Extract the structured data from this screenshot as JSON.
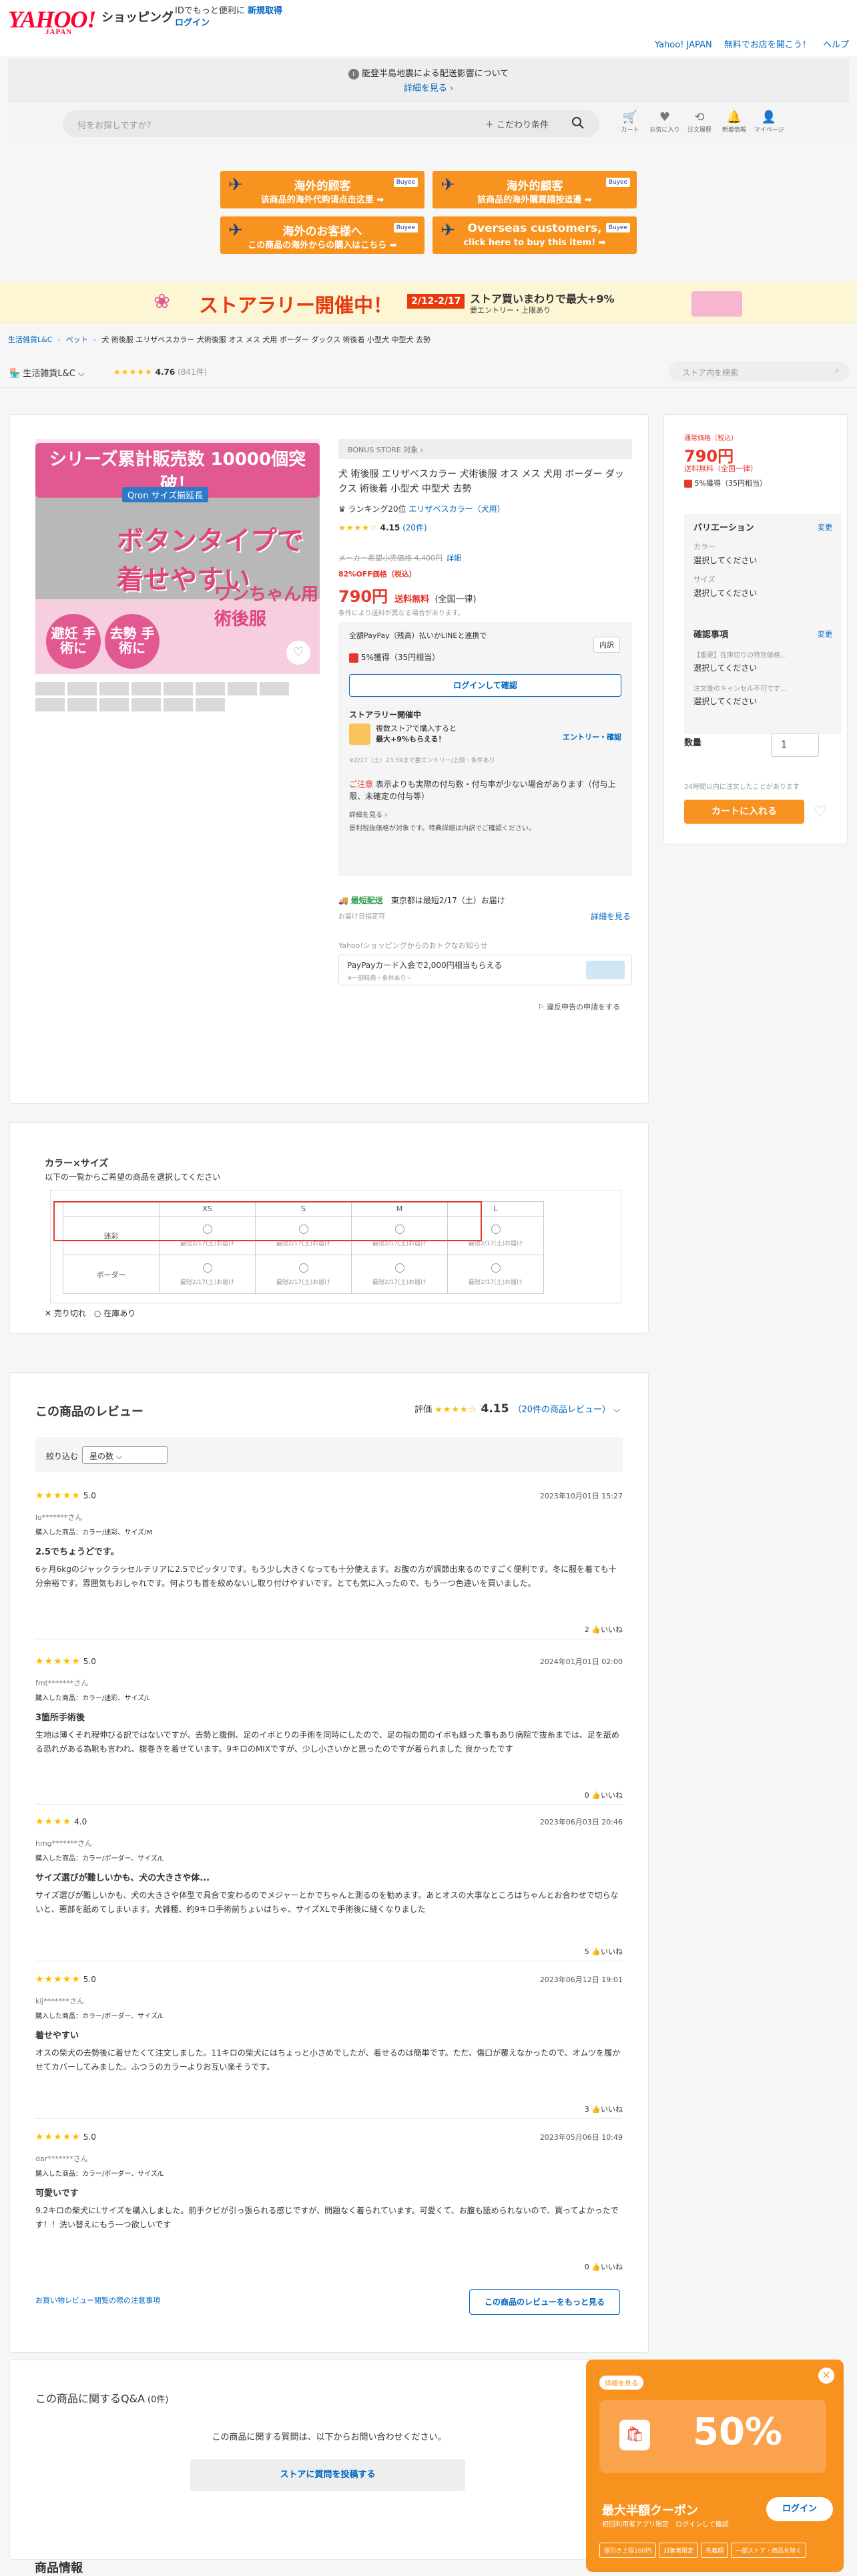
{
  "header": {
    "logo": "YAHOO!",
    "logo_sub": "JAPAN",
    "title": "ショッピング",
    "msg1": "IDでもっと便利に",
    "msg_link": "新規取得",
    "login": "ログイン",
    "right_links": [
      "Yahoo! JAPAN",
      "無料でお店を開こう！",
      "ヘルプ"
    ]
  },
  "notice": {
    "text": "能登半島地震による配送影響について",
    "link": "詳細を見る ›"
  },
  "search": {
    "placeholder": "何をお探しですか？",
    "conditions": "こだわり条件",
    "nav": [
      {
        "icon": "🛒",
        "label": "カート"
      },
      {
        "icon": "♥",
        "label": "お気に入り"
      },
      {
        "icon": "⟲",
        "label": "注文履歴"
      },
      {
        "icon": "🔔",
        "label": "新着情報"
      },
      {
        "icon": "👤",
        "label": "マイページ"
      }
    ]
  },
  "banners": [
    {
      "t1": "海外的顾客",
      "t2": "该商品的海外代购请点击这里 ➡"
    },
    {
      "t1": "海外的顧客",
      "t2": "該商品的海外購買請按這邊 ➡"
    },
    {
      "t1": "海外のお客様へ",
      "t2": "この商品の海外からの購入はこちら ➡"
    },
    {
      "t1": "Overseas customers,",
      "t2": "click here to buy this item! ➡"
    }
  ],
  "buyee": "Buyee",
  "store_rally": {
    "headline": "ストアラリー開催中！",
    "date": "2/12-2/17",
    "sub": "ストア買いまわりで最大+9%",
    "sub2": "要エントリー・上限あり"
  },
  "breadcrumb": [
    "生活雑貨L&C",
    "ペット",
    "犬 術後服 エリザベスカラー 犬術後服 オス メス 犬用 ボーダー ダックス 術後着 小型犬 中型犬 去勢"
  ],
  "store": {
    "name": "生活雑貨L&C",
    "rating": "4.76",
    "count": "(841件)",
    "search_placeholder": "ストア内を検索"
  },
  "product": {
    "image_top": "シリーズ累計販売数 10000個突破！",
    "image_brand": "Qron サイズ揃延長",
    "image_big": "ボタンタイプで着せやすい",
    "image_sub": "ワンちゃん用 術後服",
    "image_c1": "避妊 手術に",
    "image_c2": "去勢 手術に",
    "bonus": "BONUS STORE 対象 ›",
    "title": "犬 術後服 エリザベスカラー 犬術後服 オス メス 犬用 ボーダー ダックス 術後着 小型犬 中型犬 去勢",
    "rank": "ランキング20位",
    "rank_link": "エリザベスカラー（犬用）",
    "rating": "4.15",
    "reviews": "(20件)",
    "old_price": "メーカー希望小売価格 4,400円",
    "old_detail": "詳細",
    "discount": "82%OFF価格（税込）",
    "price": "790円",
    "price_suffix": "送料無料",
    "price_all": "(全国一律)",
    "price_note": "条件により送料が異なる場合があります。",
    "pay_line": "全額PayPay（残高）払いかLINEと連携で",
    "pay_btn": "内訳",
    "pay_pts": "5%獲得（35円相当）",
    "login_btn": "ログインして確認",
    "rally_h": "ストアラリー開催中",
    "rally_t1": "複数ストアで購入すると",
    "rally_t2": "最大+9%もらえる！",
    "rally_entry": "エントリー・確認",
    "rally_note": "※2/17（土）23:59まで要エントリー/上限・条件あり",
    "caution_label": "ご注意",
    "caution": "表示よりも実際の付与数・付与率が少ない場合があります（付与上限、未確定の付与等）",
    "caution_more": "詳細を見る ›",
    "caution_2": "景利税抜価格が対象です。特典詳細は内訳でご確認ください。",
    "ship_label": "最短配送",
    "ship_text": "東京都は最短2/17（土）お届け",
    "ship_note": "お届け日指定可",
    "ship_more": "詳細を見る",
    "yprom": "Yahoo!ショッピングからのおトクなお知らせ",
    "card_t": "PayPayカード入会で2,000円相当もらえる",
    "card_s": "※一部特典・条件あり ›",
    "report": "違反申告の申請をする"
  },
  "side": {
    "label": "通常価格（税込）",
    "price": "790円",
    "free": "送料無料（全国一律）",
    "pts": "5%獲得（35円相当）",
    "var_h": "バリエーション",
    "change": "変更",
    "k1": "カラー",
    "v1": "選択してください",
    "k2": "サイズ",
    "v2": "選択してください",
    "conf_h": "確認事項",
    "ck1": "【重要】在庫切りの特別価格...",
    "cv1": "選択してください",
    "ck2": "注文後のキャンセル不可です...",
    "cv2": "選択してください",
    "qty_label": "数量",
    "qty": "1",
    "note": "24時間以内に注文したことがあります",
    "cart": "カートに入れる"
  },
  "options": {
    "title": "カラー×サイズ",
    "sub": "以下の一覧からご希望の商品を選択してください",
    "cols": [
      "XS",
      "S",
      "M",
      "L"
    ],
    "rows": [
      "迷彩",
      "ボーダー"
    ],
    "cell_note": "最短2/17(土)お届け",
    "legend1": "売り切れ",
    "legend2": "在庫あり"
  },
  "reviews": {
    "title": "この商品のレビュー",
    "score_label": "評価",
    "score": "4.15",
    "score_link": "（20件の商品レビュー）",
    "filter_label": "絞り込む",
    "filter_val": "星の数",
    "items": [
      {
        "stars": "★★★★★",
        "n": "5.0",
        "date": "2023年10月01日 15:27",
        "user": "lo*******さん",
        "bought": "購入した商品：カラー/迷彩、サイズ/M",
        "title": "2.5でちょうどです。",
        "body": "6ヶ月6kgのジャックラッセルテリアに2.5でピッタリです。もう少し大きくなっても十分使えます。お腹の方が調節出来るのですごく便利です。冬に服を着ても十分余裕です。雰囲気もおしゃれです。何よりも首を絞めないし取り付けやすいです。とても気に入ったので、もう一つ色違いを買いました。",
        "likes": "2"
      },
      {
        "stars": "★★★★★",
        "n": "5.0",
        "date": "2024年01月01日 02:00",
        "user": "fmt*******さん",
        "bought": "購入した商品：カラー/迷彩、サイズ/L",
        "title": "3箇所手術後",
        "body": "生地は薄くそれ程伸びる訳ではないですが、去勢と腹側、足のイボとりの手術を同時にしたので、足の指の間のイボも縫った事もあり病院で抜糸までは、足を舐める恐れがある為靴も言われ、腹巻きを着せています。9キロのMIXですが、少し小さいかと思ったのですが着られました 良かったです",
        "likes": "0"
      },
      {
        "stars": "★★★★",
        "n": "4.0",
        "date": "2023年06月03日 20:46",
        "user": "hmg*******さん",
        "bought": "購入した商品：カラー/ボーダー、サイズ/L",
        "title": "サイズ選びが難しいかも、犬の大きさや体...",
        "body": "サイズ選びが難しいかも、犬の大きさや体型で具合で変わるのでメジャーとかでちゃんと測るのを勧めます。あとオスの大事なところはちゃんとお合わせで切らないと、悪部を舐めてしまいます。犬雑種、約9キロ手術前ちょいはちゃ、サイズXLで手術後に縫くなりました",
        "likes": "5"
      },
      {
        "stars": "★★★★★",
        "n": "5.0",
        "date": "2023年06月12日 19:01",
        "user": "kij*******さん",
        "bought": "購入した商品：カラー/ボーダー、サイズ/L",
        "title": "着せやすい",
        "body": "オスの柴犬の去勢後に着せたくて注文しました。11キロの柴犬にはちょっと小さめでしたが、着せるのは簡単です。ただ、傷口が覆えなかったので、オムツを履かせてカバーしてみました。ふつうのカラーよりお互い楽そうです。",
        "likes": "3"
      },
      {
        "stars": "★★★★★",
        "n": "5.0",
        "date": "2023年05月06日 10:49",
        "user": "dar*******さん",
        "bought": "購入した商品：カラー/ボーダー、サイズ/L",
        "title": "可愛いです",
        "body": "9.2キロの柴犬にLサイズを購入しました。前手クビが引っ張られる感じですが、問題なく着られています。可愛くて、お腹も舐められないので、買ってよかったです！！洗い替えにもう一つ欲しいです",
        "likes": "0"
      }
    ],
    "like_label": "いいね",
    "footer_link": "お買い物レビュー閲覧の際の注意事項",
    "more": "この商品のレビューをもっと見る"
  },
  "qa": {
    "title": "この商品に関するQ&A",
    "count": "(0件)",
    "msg": "この商品に関する質問は、以下からお問い合わせください。",
    "btn": "ストアに質問を投稿する"
  },
  "product_info": "商品情報",
  "coupon": {
    "tag": "詳細を見る",
    "pct": "50%",
    "title": "最大半額クーポン",
    "sub": "初回利用者アプリ限定　ログインして確認",
    "btn": "ログイン",
    "tags": [
      "値引き上限100円",
      "対象者限定",
      "先着順",
      "一部ストア・商品を除く"
    ]
  },
  "colors": {
    "accent": "#e7372c",
    "link": "#0066c0",
    "orange": "#f7911f",
    "star": "#ffbb00"
  }
}
